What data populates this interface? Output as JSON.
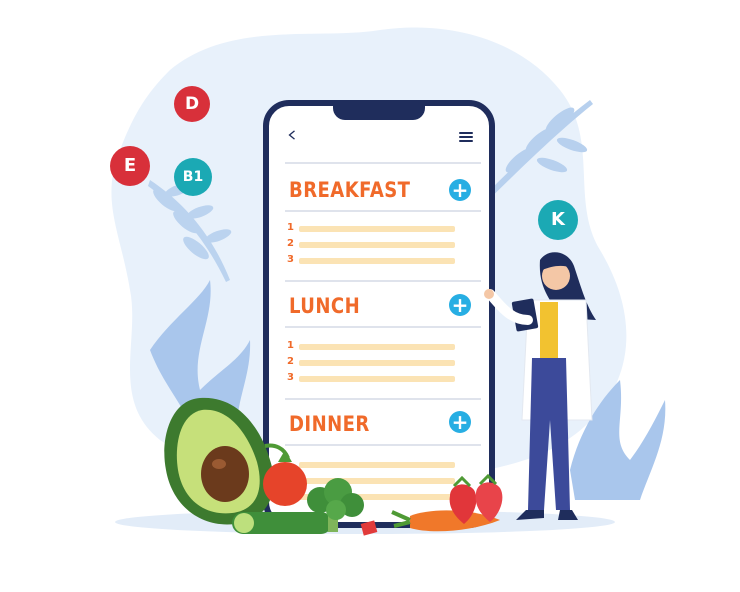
{
  "vitamins": [
    {
      "label": "D"
    },
    {
      "label": "E"
    },
    {
      "label": "B1"
    },
    {
      "label": "K"
    }
  ],
  "phone": {
    "back_icon": "chevron-left-icon",
    "menu_icon": "hamburger-menu-icon",
    "meals": [
      {
        "title": "BREAKFAST",
        "items": [
          "1",
          "2",
          "3"
        ]
      },
      {
        "title": "LUNCH",
        "items": [
          "1",
          "2",
          "3"
        ]
      },
      {
        "title": "DINNER",
        "items": []
      }
    ],
    "add_label": "+"
  },
  "colors": {
    "phone_frame": "#1f2d5c",
    "meal_title": "#f06a2a",
    "add_button": "#27aee3",
    "vitamin_red": "#d8303a",
    "vitamin_teal": "#1ba9b4",
    "blob": "#e8f1fb"
  }
}
